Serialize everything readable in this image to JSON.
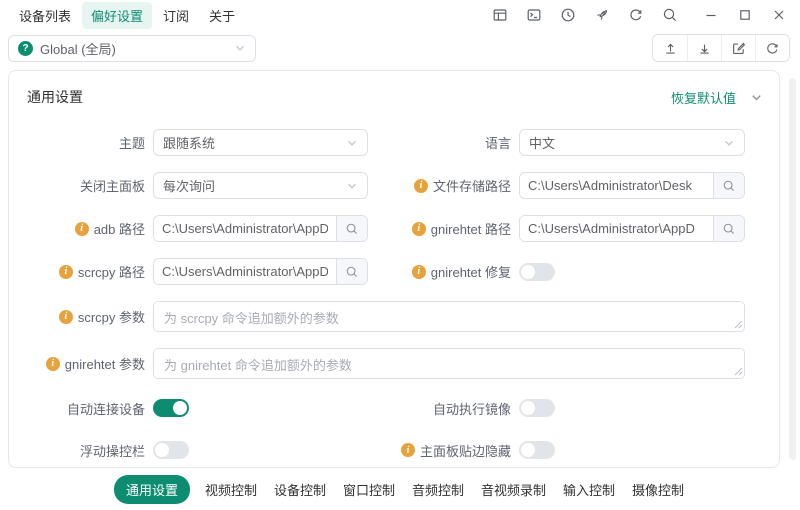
{
  "titlebar": {
    "menu": [
      {
        "label": "设备列表"
      },
      {
        "label": "偏好设置",
        "active": true
      },
      {
        "label": "订阅"
      },
      {
        "label": "关于"
      }
    ],
    "icons": [
      "layout",
      "terminal",
      "clock",
      "rocket",
      "refresh",
      "search"
    ],
    "window_controls": [
      "minimize",
      "maximize",
      "close"
    ]
  },
  "toolbar": {
    "scope_select": {
      "value": "Global (全局)",
      "icon": "question"
    },
    "buttons": [
      "upload",
      "download",
      "edit",
      "refresh"
    ]
  },
  "section": {
    "title": "通用设置",
    "reset_label": "恢复默认值"
  },
  "form": {
    "theme": {
      "label": "主题",
      "value": "跟随系统"
    },
    "language": {
      "label": "语言",
      "value": "中文"
    },
    "close_panel": {
      "label": "关闭主面板",
      "value": "每次询问"
    },
    "file_path": {
      "label": "文件存储路径",
      "info": true,
      "value": "C:\\Users\\Administrator\\Desk"
    },
    "adb_path": {
      "label": "adb 路径",
      "info": true,
      "value": "C:\\Users\\Administrator\\AppD"
    },
    "gnirehtet_path": {
      "label": "gnirehtet 路径",
      "info": true,
      "value": "C:\\Users\\Administrator\\AppD"
    },
    "scrcpy_path": {
      "label": "scrcpy 路径",
      "info": true,
      "value": "C:\\Users\\Administrator\\AppD"
    },
    "gnirehtet_fix": {
      "label": "gnirehtet 修复",
      "info": true,
      "on": false
    },
    "scrcpy_args": {
      "label": "scrcpy 参数",
      "info": true,
      "placeholder": "为 scrcpy 命令追加额外的参数"
    },
    "gnirehtet_args": {
      "label": "gnirehtet 参数",
      "info": true,
      "placeholder": "为 gnirehtet 命令追加额外的参数"
    },
    "auto_connect": {
      "label": "自动连接设备",
      "on": true
    },
    "auto_mirror": {
      "label": "自动执行镜像",
      "on": false
    },
    "float_bar": {
      "label": "浮动操控栏",
      "on": false
    },
    "edge_hide": {
      "label": "主面板贴边隐藏",
      "info": true,
      "on": false
    }
  },
  "tabs": [
    {
      "label": "通用设置",
      "active": true
    },
    {
      "label": "视频控制"
    },
    {
      "label": "设备控制"
    },
    {
      "label": "窗口控制"
    },
    {
      "label": "音频控制"
    },
    {
      "label": "音视频录制"
    },
    {
      "label": "输入控制"
    },
    {
      "label": "摄像控制"
    }
  ],
  "colors": {
    "primary": "#0d8c72",
    "primary_light_bg": "#e7f5f0",
    "warning": "#e6a23c",
    "border": "#dcdfe6"
  }
}
